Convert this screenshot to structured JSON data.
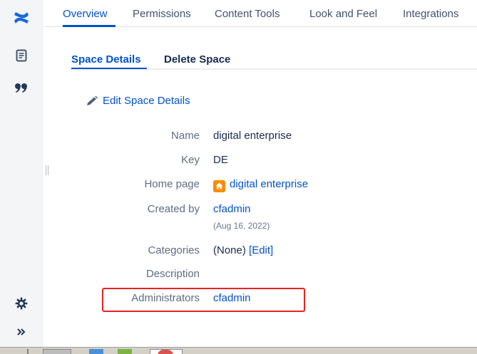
{
  "top_nav": {
    "tabs": [
      {
        "label": "Overview",
        "active": true
      },
      {
        "label": "Permissions",
        "active": false
      },
      {
        "label": "Content Tools",
        "active": false
      },
      {
        "label": "Look and Feel",
        "active": false
      },
      {
        "label": "Integrations",
        "active": false
      }
    ]
  },
  "sub_nav": {
    "tabs": [
      {
        "label": "Space Details",
        "active": true
      },
      {
        "label": "Delete Space",
        "active": false
      }
    ]
  },
  "edit_link": {
    "label": "Edit Space Details",
    "icon": "pencil-icon"
  },
  "details": {
    "name": {
      "label": "Name",
      "value": "digital enterprise"
    },
    "key": {
      "label": "Key",
      "value": "DE"
    },
    "home_page": {
      "label": "Home page",
      "value": "digital enterprise",
      "icon": "home-icon"
    },
    "created_by": {
      "label": "Created by",
      "value": "cfadmin",
      "date": "(Aug 16, 2022)"
    },
    "categories": {
      "label": "Categories",
      "value": "(None)",
      "edit": "[Edit]"
    },
    "description": {
      "label": "Description",
      "value": ""
    },
    "administrators": {
      "label": "Administrators",
      "value": "cfadmin"
    }
  },
  "sidebar": {
    "icons": [
      "confluence-logo-icon",
      "pages-icon",
      "quote-icon",
      "settings-icon",
      "expand-icon"
    ]
  },
  "colors": {
    "accent": "#0052cc",
    "highlight": "#e8231f",
    "home_badge": "#ff8b00"
  }
}
